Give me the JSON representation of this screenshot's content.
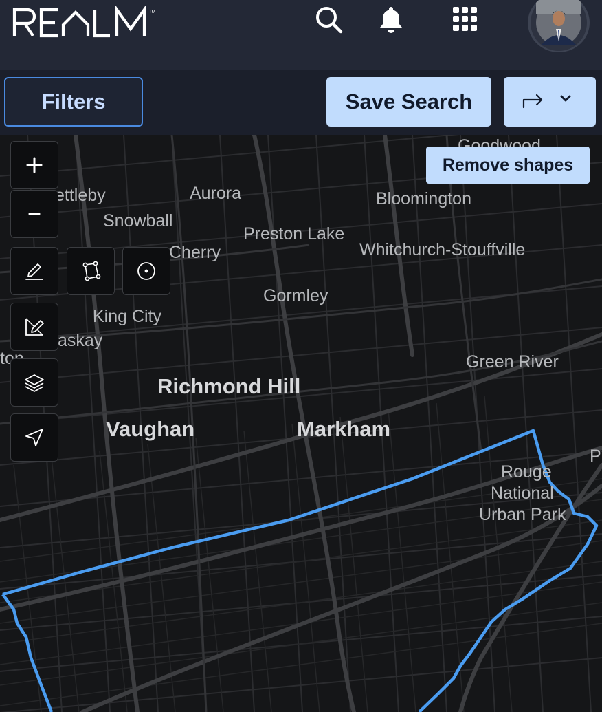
{
  "header": {
    "logo_text": "REALM",
    "logo_mark": "™",
    "icons": [
      "search-icon",
      "bell-icon",
      "grid-menu-icon"
    ],
    "avatar": "user-avatar"
  },
  "toolbar": {
    "filters_label": "Filters",
    "save_label": "Save Search",
    "share_icons": [
      "share-arrow-icon",
      "chevron-down-icon"
    ]
  },
  "map": {
    "remove_shapes_label": "Remove shapes",
    "controls": [
      "zoom-in-icon",
      "zoom-out-icon",
      "pencil-draw-icon",
      "polygon-draw-icon",
      "circle-draw-icon",
      "edit-shape-icon",
      "layers-icon",
      "locate-icon"
    ],
    "places": {
      "goodwood": "Goodwood",
      "schomberg": "ettleby",
      "aurora": "Aurora",
      "bloomington": "Bloomington",
      "snowball": "Snowball",
      "preston_lake": "Preston Lake",
      "cherry": "Cherry",
      "stouffville": "Whitchurch-Stouffville",
      "gormley": "Gormley",
      "king_city": "King City",
      "kettleby": "askay",
      "bolton": "ton",
      "green_river": "Green River",
      "richmond_hill": "Richmond Hill",
      "vaughan": "Vaughan",
      "markham": "Markham",
      "pickering": "P",
      "rouge_1": "Rouge",
      "rouge_2": "National",
      "rouge_3": "Urban Park"
    },
    "boundary_color": "#4a9cf0"
  }
}
